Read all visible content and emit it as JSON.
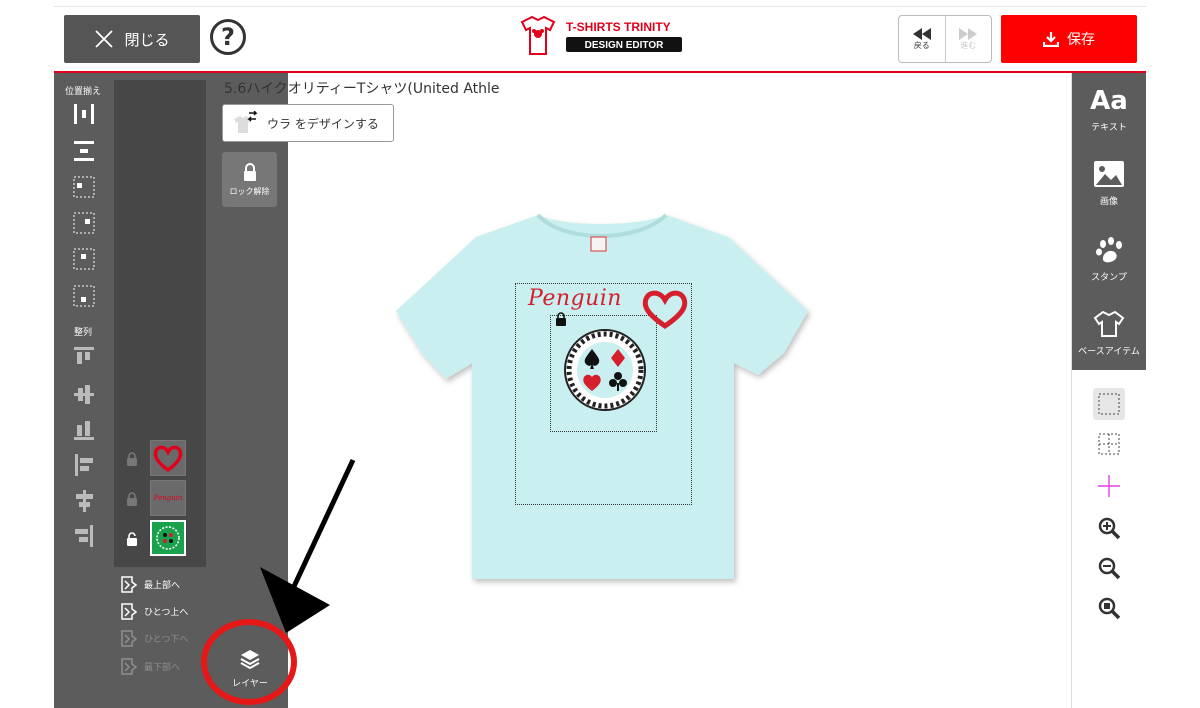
{
  "header": {
    "close_label": "閉じる",
    "help_symbol": "?",
    "logo_line1": "T-SHIRTS TRINITY",
    "logo_line2": "DESIGN EDITOR",
    "undo_label": "戻る",
    "redo_label": "進む",
    "save_label": "保存"
  },
  "left_tools": {
    "align_section": "位置揃え",
    "arrange_section": "整列"
  },
  "layers": {
    "items": [
      {
        "name": "heart",
        "locked": true
      },
      {
        "name": "penguin-text",
        "locked": true
      },
      {
        "name": "cards-medallion",
        "locked": false,
        "selected": true
      }
    ],
    "order": {
      "bring_front": "最上部へ",
      "forward": "ひとつ上へ",
      "backward": "ひとつ下へ",
      "send_back": "最下部へ"
    },
    "layer_button": "レイヤー"
  },
  "thumbs": {
    "penguin_small": "Penguin"
  },
  "canvas": {
    "product_name": "5.6ハイクオリティーTシャツ(United Athle",
    "back_design": "ウラ をデザインする",
    "unlock": "ロック解除",
    "design_text": "Penguin",
    "shirt_color": "#c9eff0"
  },
  "right_tools": {
    "text_icon": "Aa",
    "text": "テキスト",
    "image": "画像",
    "stamp": "スタンプ",
    "base_item": "ベースアイテム"
  },
  "colors": {
    "accent_red": "#ff0000",
    "panel_gray": "#5c5c5c",
    "heart_red": "#d51f2c"
  }
}
